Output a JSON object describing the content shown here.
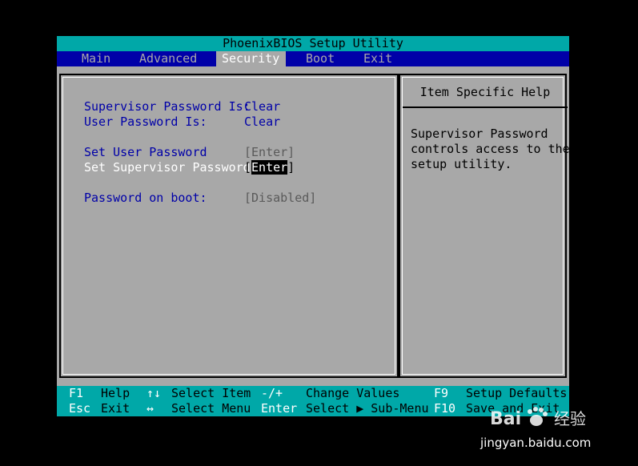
{
  "title": "PhoenixBIOS Setup Utility",
  "menu": [
    {
      "label": "Main",
      "active": false
    },
    {
      "label": "Advanced",
      "active": false
    },
    {
      "label": "Security",
      "active": true
    },
    {
      "label": "Boot",
      "active": false
    },
    {
      "label": "Exit",
      "active": false
    }
  ],
  "settings": {
    "supervisor_password_is": {
      "label": "Supervisor Password Is:",
      "value": "Clear"
    },
    "user_password_is": {
      "label": "User Password Is:",
      "value": "Clear"
    },
    "set_user_password": {
      "label": "Set User Password",
      "value": "[Enter]"
    },
    "set_supervisor_password": {
      "label": "Set Supervisor Password",
      "value_open": "[",
      "value_highlight": "Enter",
      "value_close": "]"
    },
    "password_on_boot": {
      "label": "Password on boot:",
      "value": "[Disabled]"
    }
  },
  "help": {
    "title": "Item Specific Help",
    "text": "Supervisor Password\ncontrols access to the\nsetup utility."
  },
  "footer": {
    "row1": [
      {
        "key": "F1",
        "desc": "Help"
      },
      {
        "key": "↑↓",
        "desc": "Select Item"
      },
      {
        "key": "-/+",
        "desc": "Change Values"
      },
      {
        "key": "F9",
        "desc": "Setup Defaults"
      }
    ],
    "row2": [
      {
        "key": "Esc",
        "desc": "Exit"
      },
      {
        "key": "↔",
        "desc": "Select Menu"
      },
      {
        "key": "Enter",
        "desc": "Select ▶ Sub-Menu"
      },
      {
        "key": "F10",
        "desc": "Save and Exit"
      }
    ]
  },
  "watermark": {
    "brand": "Bai",
    "brand_suffix": "经验",
    "url": "jingyan.baidu.com"
  },
  "colors": {
    "cyan": "#00a8a8",
    "blue": "#0000a8",
    "gray": "#a8a8a8",
    "white": "#ffffff",
    "black": "#000000"
  }
}
